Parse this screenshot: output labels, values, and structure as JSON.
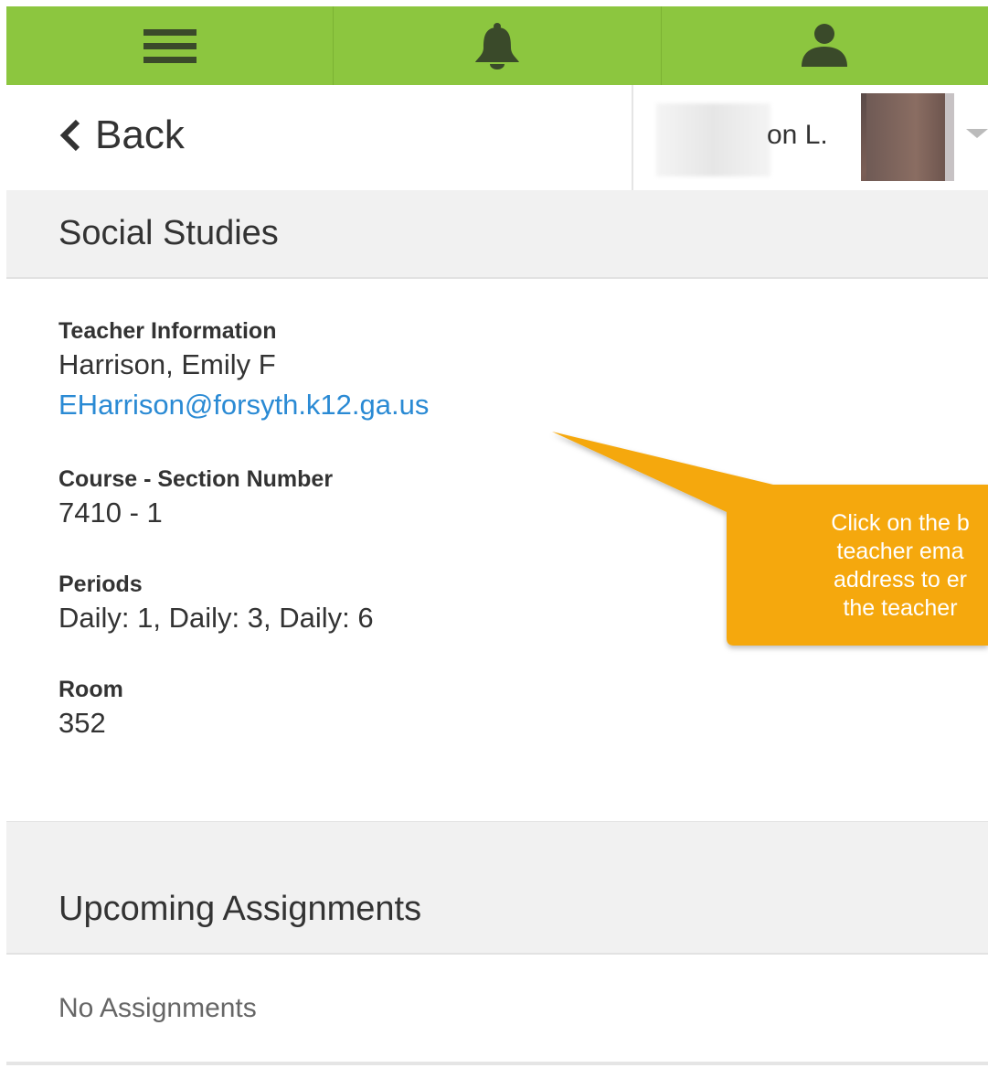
{
  "topbar": {
    "color": "#8cc63f",
    "icons": [
      "hamburger-menu-icon",
      "bell-icon",
      "user-icon"
    ]
  },
  "header": {
    "back_label": "Back",
    "user_name": "on L."
  },
  "course": {
    "title": "Social Studies"
  },
  "details": {
    "teacher_label": "Teacher Information",
    "teacher_name": "Harrison, Emily F",
    "teacher_email": "EHarrison@forsyth.k12.ga.us",
    "course_section_label": "Course - Section Number",
    "course_section_value": "7410 - 1",
    "periods_label": "Periods",
    "periods_value": "Daily: 1, Daily: 3, Daily: 6",
    "room_label": "Room",
    "room_value": "352"
  },
  "callout": {
    "color": "#f5a80d",
    "lines": [
      "Click on the b",
      "teacher ema",
      "address to er",
      "the teacher"
    ]
  },
  "assignments": {
    "title": "Upcoming Assignments",
    "empty_text": "No Assignments"
  }
}
